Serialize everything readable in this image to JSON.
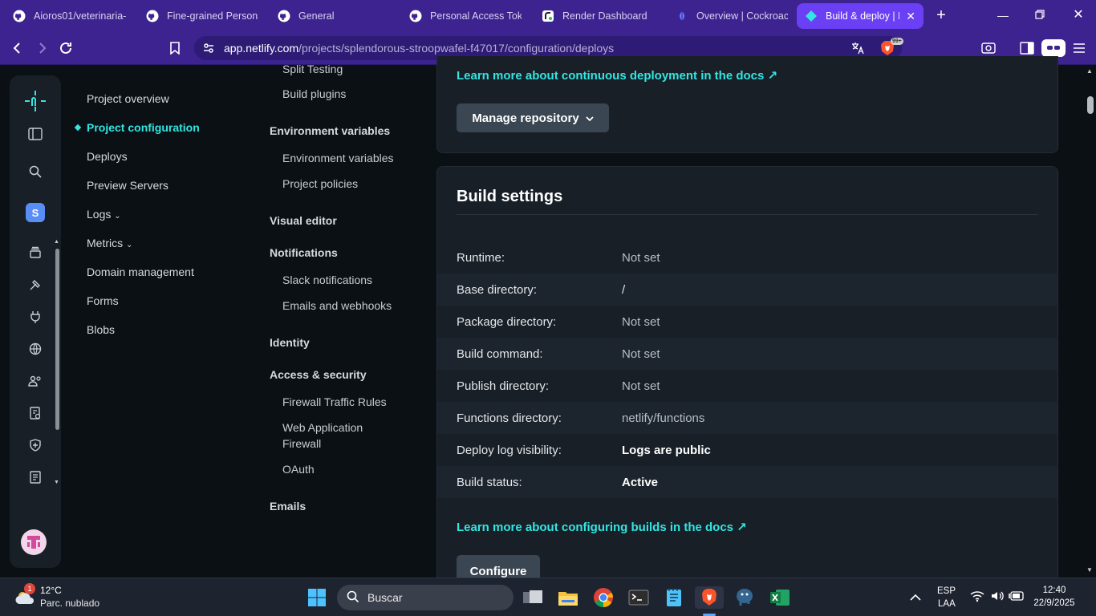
{
  "browser": {
    "tabs": [
      {
        "title": "Aioros01/veterinaria-",
        "icon": "github-icon"
      },
      {
        "title": "Fine-grained Personal",
        "icon": "github-icon"
      },
      {
        "title": "General",
        "icon": "github-icon"
      },
      {
        "title": "Personal Access Token",
        "icon": "github-icon"
      },
      {
        "title": "Render Dashboard",
        "icon": "render-icon"
      },
      {
        "title": "Overview | Cockroach",
        "icon": "cockroach-icon"
      },
      {
        "title": "Build & deploy | N",
        "icon": "netlify-icon",
        "active": true
      }
    ],
    "url_host": "app.netlify.com",
    "url_path": "/projects/splendorous-stroopwafel-f47017/configuration/deploys",
    "brave_badge": "99+",
    "accent": "#6b3ff3"
  },
  "rail": {
    "avatar_letter": "S"
  },
  "leftnav": [
    {
      "label": "Project overview"
    },
    {
      "label": "Project configuration",
      "active": true
    },
    {
      "label": "Deploys"
    },
    {
      "label": "Preview Servers"
    },
    {
      "label": "Logs",
      "chevron": true
    },
    {
      "label": "Metrics",
      "chevron": true
    },
    {
      "label": "Domain management"
    },
    {
      "label": "Forms"
    },
    {
      "label": "Blobs"
    }
  ],
  "subnav": {
    "split_testing": "Split Testing",
    "build_plugins": "Build plugins",
    "env_heading": "Environment variables",
    "env_vars": "Environment variables",
    "project_policies": "Project policies",
    "visual_editor": "Visual editor",
    "notifications": "Notifications",
    "slack": "Slack notifications",
    "emails_webhooks": "Emails and webhooks",
    "identity": "Identity",
    "access_security": "Access & security",
    "firewall_rules": "Firewall Traffic Rules",
    "waf_line1": "Web Application",
    "waf_line2": "Firewall",
    "oauth": "OAuth",
    "emails": "Emails"
  },
  "repo_card": {
    "docs_link": "Learn more about continuous deployment in the docs ↗",
    "manage_button": "Manage repository"
  },
  "build_settings": {
    "title": "Build settings",
    "rows": [
      {
        "key": "Runtime:",
        "value": "Not set"
      },
      {
        "key": "Base directory:",
        "value": "/"
      },
      {
        "key": "Package directory:",
        "value": "Not set"
      },
      {
        "key": "Build command:",
        "value": "Not set"
      },
      {
        "key": "Publish directory:",
        "value": "Not set"
      },
      {
        "key": "Functions directory:",
        "value": "netlify/functions"
      },
      {
        "key": "Deploy log visibility:",
        "value": "Logs are public"
      },
      {
        "key": "Build status:",
        "value": "Active"
      }
    ],
    "docs_link": "Learn more about configuring builds in the docs ↗",
    "configure_button": "Configure"
  },
  "taskbar": {
    "weather_temp": "12°C",
    "weather_desc": "Parc. nublado",
    "weather_badge": "1",
    "search_placeholder": "Buscar",
    "lang_top": "ESP",
    "lang_bottom": "LAA",
    "time": "12:40",
    "date": "22/9/2025"
  }
}
